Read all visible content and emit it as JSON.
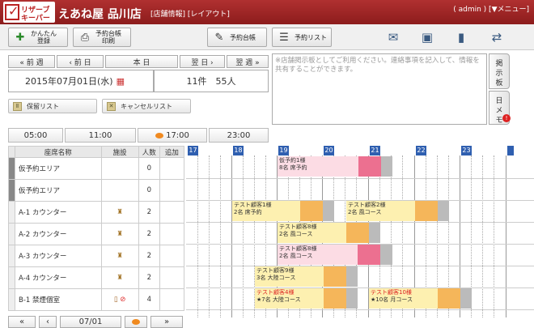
{
  "header": {
    "logo_line1": "リザーブ",
    "logo_line2": "キーパー",
    "shop_name": "えあね屋 品川店",
    "links": "[店舗情報] [レイアウト]",
    "admin": "( admin ) [▼メニュー]"
  },
  "toolbar": {
    "easy_reg": "かんたん\n登録",
    "print_book": "予約台帳\n印刷",
    "book": "予約台帳",
    "list": "予約リスト"
  },
  "nav": {
    "prev_week": "« 前 週",
    "prev_day": "‹ 前 日",
    "today": "本 日",
    "next_day": "翌 日 ›",
    "next_week": "翌 週 »"
  },
  "date": "2015年07月01日(水)",
  "summary": "11件　55人",
  "buttons": {
    "hold": "保留リスト",
    "cancel": "キャンセルリスト"
  },
  "board": {
    "placeholder": "※店舗掲示板としてご利用ください。連絡事項を記入して、情報を共有することができます。"
  },
  "side_tabs": {
    "board": "掲示板",
    "memo": "日メモ"
  },
  "times": [
    "05:00",
    "11:00",
    "17:00",
    "23:00"
  ],
  "table": {
    "headers": [
      "座席名称",
      "施設",
      "人数",
      "追加"
    ],
    "rows": [
      {
        "name": "仮予約エリア",
        "count": "0"
      },
      {
        "name": "仮予約エリア",
        "count": "0"
      },
      {
        "name": "A-1 カウンター",
        "count": "2"
      },
      {
        "name": "A-2 カウンター",
        "count": "2"
      },
      {
        "name": "A-3 カウンター",
        "count": "2"
      },
      {
        "name": "A-4 カウンター",
        "count": "2"
      },
      {
        "name": "B-1 禁煙個室",
        "count": "4"
      }
    ]
  },
  "hours": [
    "17",
    "18",
    "19",
    "20",
    "21",
    "22",
    "23"
  ],
  "reservations": [
    {
      "l1": "仮予約1様",
      "l2": "8名 席予約",
      "kind": "pink"
    },
    {
      "l1": "テスト顧客1様",
      "l2": "2名 席予約",
      "kind": "yellow"
    },
    {
      "l1": "テスト顧客2様",
      "l2": "2名 風コース",
      "kind": "yellow"
    },
    {
      "l1": "テスト顧客8様",
      "l2": "2名 風コース",
      "kind": "yellow"
    },
    {
      "l1": "テスト顧客8様",
      "l2": "2名 風コース",
      "kind": "pink"
    },
    {
      "l1": "テスト顧客9様",
      "l2": "3名 大陸コース",
      "kind": "yellow"
    },
    {
      "l1": "テスト顧客4様",
      "l2": "★7名 大陸コース",
      "kind": "red"
    },
    {
      "l1": "テスト顧客10様",
      "l2": "★10名 月コース",
      "kind": "red"
    }
  ],
  "bottom": {
    "date": "07/01"
  },
  "colors": {
    "header": "#a02424",
    "hour": "#2f5fb0",
    "yellow": "#fdf0b0",
    "pink": "#fcdce4",
    "orange": "#f5b65a",
    "pinkend": "#ec7090"
  }
}
